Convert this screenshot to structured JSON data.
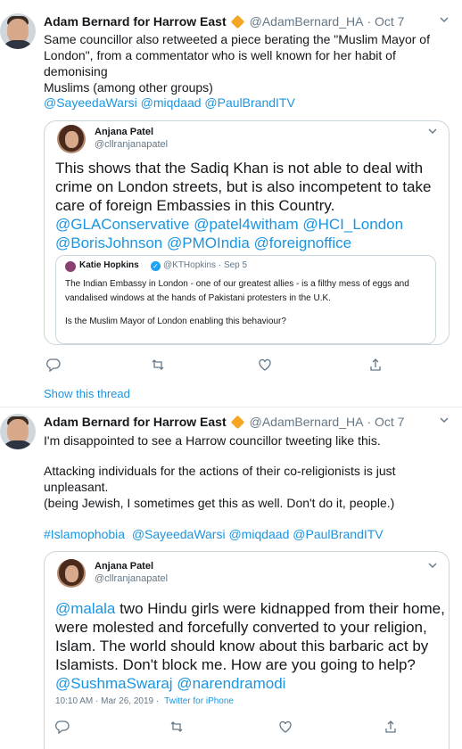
{
  "tweets": [
    {
      "author_name": "Adam Bernard for Harrow East",
      "handle": "@AdamBernard_HA",
      "date": "· Oct 7",
      "text_lines": [
        "Same councillor also retweeted a piece berating the \"Muslim Mayor of",
        "London\", from a commentator who is well known for her habit of demonising",
        "Muslims (among other groups)"
      ],
      "mentions": "@SayeedaWarsi @miqdaad @PaulBrandITV",
      "quote": {
        "author_name": "Anjana Patel",
        "handle": "@cllranjanapatel",
        "text_lines": [
          "This shows that the Sadiq Khan is not able to deal with",
          "crime on London streets, but is also incompetent to take",
          "care of foreign Embassies in this Country."
        ],
        "link_lines": [
          "@GLAConservative @patel4witham @HCI_London",
          "@BorisJohnson @PMOIndia @foreignoffice"
        ],
        "nested": {
          "author_name": "Katie Hopkins",
          "verified_icon": "✓",
          "handle_date": "@KTHopkins · Sep 5",
          "text_lines": [
            "The Indian Embassy in London - one of our greatest allies - is a filthy mess of eggs and",
            "vandalised windows at the hands of Pakistani protesters in the U.K.",
            "Is the Muslim Mayor of London enabling this behaviour?"
          ]
        }
      },
      "show_thread": "Show this thread"
    },
    {
      "author_name": "Adam Bernard for Harrow East",
      "handle": "@AdamBernard_HA",
      "date": "· Oct 7",
      "paragraphs": [
        "I'm disappointed to see a Harrow councillor tweeting like this.",
        "Attacking individuals for the actions of their co-religionists is just unpleasant.",
        "(being Jewish, I sometimes get this as well. Don't do it, people.)"
      ],
      "hashtags": "#Islamophobia  @SayeedaWarsi @miqdaad @PaulBrandITV",
      "quote": {
        "author_name": "Anjana Patel",
        "handle": "@cllranjanapatel",
        "mention": "@malala",
        "text_first": " two Hindu girls were kidnapped from their home,",
        "text_lines": [
          "were molested and forcefully converted to your religion,",
          "Islam. The world should know about this barbaric act by",
          "Islamists. Don't block me. How are you going to help?"
        ],
        "link_line": "@SushmaSwaraj @narendramodi",
        "timestamp": "10:10 AM · Mar 26, 2019 ·",
        "source": "Twitter for iPhone"
      }
    }
  ],
  "icons": {
    "more": "chevron-down-icon",
    "reply": "reply-icon",
    "retweet": "retweet-icon",
    "like": "heart-icon",
    "share": "share-icon",
    "verified": "verified-icon",
    "badge": "diamond-badge-icon"
  },
  "colors": {
    "link": "#1b95e0",
    "badge": "#f5a623",
    "muted": "#657786",
    "border": "#ccd6dd"
  }
}
